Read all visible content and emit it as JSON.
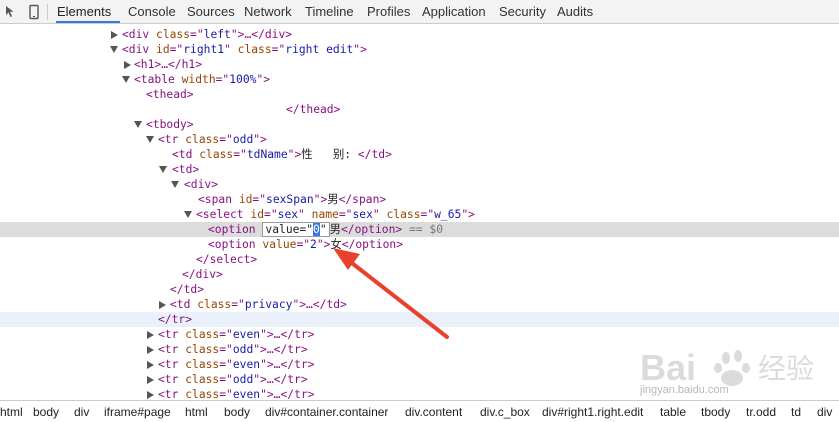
{
  "toolbar": {
    "tabs": [
      "Elements",
      "Console",
      "Sources",
      "Network",
      "Timeline",
      "Profiles",
      "Application",
      "Security",
      "Audits"
    ],
    "active_tab": "Elements",
    "accent": "#3879d9"
  },
  "dom_tree": {
    "r1": {
      "tag_open": "<div ",
      "attr": "class",
      "eq": "=\"",
      "val": "left",
      "tail": "\">…</div>"
    },
    "r2": {
      "a": "<div ",
      "id_attr": "id",
      "id_val": "right1",
      "class_attr": "class",
      "class_val": "right edit",
      "end": "\">"
    },
    "r3": {
      "text": "<h1>…</h1>"
    },
    "r4": {
      "a": "<table ",
      "attr": "width",
      "val": "100%",
      "end": "\">"
    },
    "r5": {
      "text": "<thead>"
    },
    "r6": {
      "text": "</thead>"
    },
    "r7": {
      "text": "<tbody>"
    },
    "r8": {
      "a": "<tr ",
      "attr": "class",
      "val": "odd",
      "end": "\">"
    },
    "r9": {
      "a": "<td ",
      "attr": "class",
      "val": "tdName",
      "mid": "\">",
      "content": "性   别:",
      "end": " </td>"
    },
    "r10": {
      "text": "<td>"
    },
    "r11": {
      "text": "<div>"
    },
    "r12": {
      "a": "<span ",
      "attr": "id",
      "val": "sexSpan",
      "mid": "\">",
      "content": "男",
      "end": "</span>"
    },
    "r13": {
      "a": "<select ",
      "id_attr": "id",
      "id_val": "sex",
      "name_attr": "name",
      "name_val": "sex",
      "class_attr": "class",
      "class_val": "w_65",
      "end": "\">"
    },
    "r14": {
      "a": "<option ",
      "edit_pre": "value=\"",
      "edit_val": "0",
      "edit_post": "\"",
      "content": "男",
      "end": "</option>",
      "marker": " == $0"
    },
    "r15": {
      "a": "<option ",
      "attr": "value",
      "val": "2",
      "mid": "\">",
      "content": "女",
      "end": "</option>"
    },
    "r16": {
      "text": "</select>"
    },
    "r17": {
      "text": "</div>"
    },
    "r18": {
      "text": "</td>"
    },
    "r19": {
      "a": "<td ",
      "attr": "class",
      "val": "privacy",
      "end": "\">…</td>"
    },
    "r20": {
      "text": "</tr>"
    },
    "r21": {
      "a": "<tr ",
      "attr": "class",
      "val": "even",
      "end": "\">…</tr>"
    },
    "r22": {
      "a": "<tr ",
      "attr": "class",
      "val": "odd",
      "end": "\">…</tr>"
    },
    "r23": {
      "a": "<tr ",
      "attr": "class",
      "val": "even",
      "end": "\">…</tr>"
    },
    "r24": {
      "a": "<tr ",
      "attr": "class",
      "val": "odd",
      "end": "\">…</tr>"
    },
    "r25": {
      "a": "<tr ",
      "attr": "class",
      "val": "even",
      "end": "\">…</tr>"
    }
  },
  "breadcrumbs": [
    "html",
    "body",
    "div",
    "iframe#page",
    "html",
    "body",
    "div#container.container",
    "div.content",
    "div.c_box",
    "div#right1.right.edit",
    "table",
    "tbody",
    "tr.odd",
    "td",
    "div"
  ],
  "watermark": {
    "brand": "Bai",
    "brand2": "经验",
    "url": "jingyan.baidu.com"
  },
  "annotation": {
    "arrow_color": "#e8412c"
  }
}
